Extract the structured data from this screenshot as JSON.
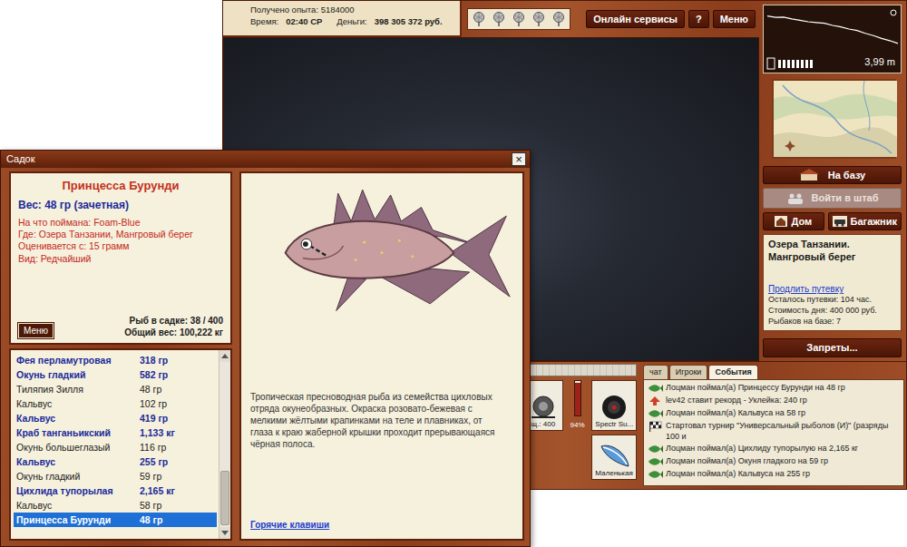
{
  "game": {
    "experience": "Получено опыта: 5184000",
    "time_label": "Время:",
    "time": "02:40 СР",
    "money_label": "Деньги:",
    "money": "398 305 372 руб.",
    "top_buttons": [
      {
        "label": "Онлайн сервисы"
      },
      {
        "label": "?"
      },
      {
        "label": "Меню"
      }
    ],
    "depth": {
      "reading": "3,99 m",
      "profile": [
        0.2,
        0.4,
        0.35,
        0.6,
        0.8,
        1.0,
        1.1,
        1.2,
        1.5,
        1.7,
        2.0,
        2.2,
        2.6,
        2.9,
        3.3,
        3.6,
        3.99
      ],
      "meter_level": 1
    },
    "sidebar": {
      "base_button": "На базу",
      "hq_button": {
        "label": "Войти в штаб",
        "disabled": true
      },
      "home_button": "Дом",
      "trunk_button": "Багажник",
      "location": "Озера Танзании. Мангровый берег",
      "extend_link": "Продлить путевку",
      "info_lines": [
        "Осталось путевки: 104 час.",
        "Стоимость дня: 400 000 руб.",
        "Рыбаков на базе: 7"
      ],
      "bans_button": "Запреты..."
    },
    "tackle": {
      "reel_label": "щ.: 400",
      "wear": "94%",
      "wear_level": 0.94,
      "line_label": "Spectr Su...",
      "lure_label": "Маленькая"
    },
    "chat": {
      "tabs": [
        {
          "label": "чат",
          "selected": false
        },
        {
          "label": "Игроки",
          "selected": false
        },
        {
          "label": "События",
          "selected": true
        }
      ],
      "events": [
        {
          "kind": "catch",
          "text": "Лоцман поймал(а) Принцессу Бурунди на 48 гр"
        },
        {
          "kind": "record",
          "text": "lev42 ставит рекорд - Уклейка: 240 гр"
        },
        {
          "kind": "catch",
          "text": "Лоцман поймал(а) Кальвуса на 58 гр"
        },
        {
          "kind": "tournament",
          "text": "Стартовал турнир \"Универсальный рыболов (И)\" (разряды 100 и"
        },
        {
          "kind": "catch",
          "text": "Лоцман поймал(а) Цихлиду тупорылую на 2,165 кг"
        },
        {
          "kind": "catch",
          "text": "Лоцман поймал(а) Окуня гладкого на 59 гр"
        },
        {
          "kind": "catch",
          "text": "Лоцман поймал(а) Кальвуса на 255 гр"
        }
      ]
    }
  },
  "keepnet": {
    "title": "Садок",
    "close": "×",
    "fish": {
      "name": "Принцесса Бурунди",
      "weight": "Вес: 48 гр (зачетная)",
      "details": [
        "На что поймана: Foam-Blue",
        "Где: Озера Танзании, Мангровый берег",
        "Оценивается с: 15 грамм",
        "Вид: Редчайший"
      ],
      "description": "Тропическая пресноводная рыба из семейства цихловых отряда окунеобразных. Окраска розовато-бежевая с мелкими жёлтыми крапинками на теле и плавниках, от глаза к краю жаберной крышки проходит прерывающаяся чёрная полоса."
    },
    "menu_button": "Меню",
    "count": "Рыб в садке: 38 / 400",
    "total_weight": "Общий вес: 100,222 кг",
    "rows": [
      {
        "name": "Фея перламутровая",
        "weight": "318 гр",
        "trophy": true,
        "selected": false
      },
      {
        "name": "Окунь гладкий",
        "weight": "582 гр",
        "trophy": true,
        "selected": false
      },
      {
        "name": "Тиляпия Зилля",
        "weight": "48 гр",
        "trophy": false,
        "selected": false
      },
      {
        "name": "Кальвус",
        "weight": "102 гр",
        "trophy": false,
        "selected": false
      },
      {
        "name": "Кальвус",
        "weight": "419 гр",
        "trophy": true,
        "selected": false
      },
      {
        "name": "Краб танганьикский",
        "weight": "1,133 кг",
        "trophy": true,
        "selected": false
      },
      {
        "name": "Окунь большеглазый",
        "weight": "116 гр",
        "trophy": false,
        "selected": false
      },
      {
        "name": "Кальвус",
        "weight": "255 гр",
        "trophy": true,
        "selected": false
      },
      {
        "name": "Окунь гладкий",
        "weight": "59 гр",
        "trophy": false,
        "selected": false
      },
      {
        "name": "Цихлида тупорылая",
        "weight": "2,165 кг",
        "trophy": true,
        "selected": false
      },
      {
        "name": "Кальвус",
        "weight": "58 гр",
        "trophy": false,
        "selected": false
      },
      {
        "name": "Принцесса Бурунди",
        "weight": "48 гр",
        "trophy": false,
        "selected": true
      }
    ],
    "scroll_level": 1,
    "hotkeys_link": "Горячие клавиши"
  }
}
